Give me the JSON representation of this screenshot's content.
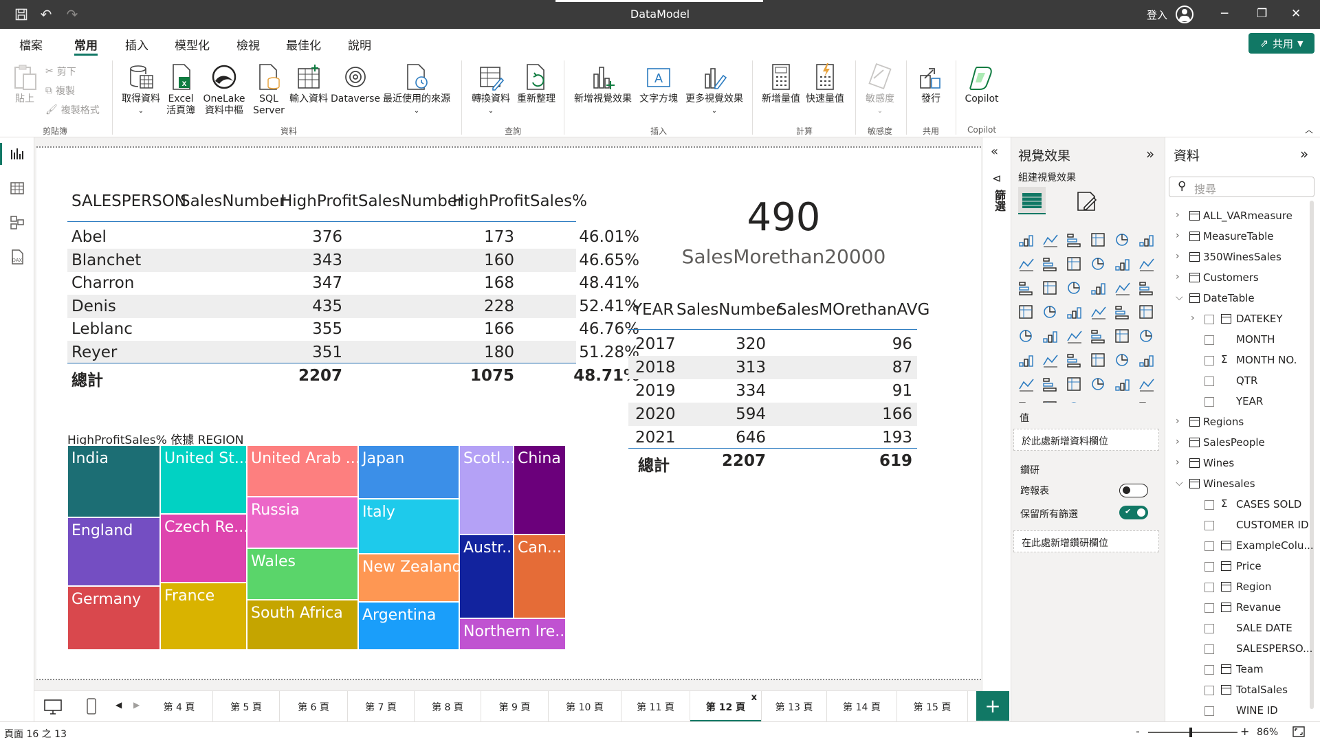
{
  "window": {
    "title": "DataModel",
    "login": "登入",
    "minimize": "─",
    "maximize": "❐",
    "close": "✕"
  },
  "menu": {
    "items": [
      "檔案",
      "常用",
      "插入",
      "模型化",
      "檢視",
      "最佳化",
      "說明"
    ],
    "active": "常用",
    "share": "共用"
  },
  "ribbon": {
    "clipboard": {
      "paste": "貼上",
      "cut": "剪下",
      "copy": "複製",
      "format_painter": "複製格式",
      "group": "剪貼簿"
    },
    "data": {
      "get_data": "取得資料",
      "excel": "Excel\n活頁簿",
      "onelake": "OneLake\n資料中樞",
      "sql": "SQL\nServer",
      "enter_data": "輸入資料",
      "dataverse": "Dataverse",
      "recent": "最近使用的來源",
      "group": "資料"
    },
    "query": {
      "transform": "轉換資料",
      "refresh": "重新整理",
      "group": "查詢"
    },
    "insert": {
      "new_visual": "新增視覺效果",
      "text_box": "文字方塊",
      "more_visuals": "更多視覺效果",
      "group": "插入"
    },
    "calc": {
      "new_measure": "新增量值",
      "quick_measure": "快速量值",
      "group": "計算"
    },
    "sensitivity": {
      "label": "敏感度",
      "group": "敏感度"
    },
    "share": {
      "publish": "發行",
      "group": "共用"
    },
    "copilot": {
      "label": "Copilot",
      "group": "Copilot"
    }
  },
  "table1": {
    "headers": [
      "SALESPERSON",
      "SalesNumber",
      "HighProfitSalesNumber",
      "HighProfitSales%"
    ],
    "rows": [
      [
        "Abel",
        "376",
        "173",
        "46.01%"
      ],
      [
        "Blanchet",
        "343",
        "160",
        "46.65%"
      ],
      [
        "Charron",
        "347",
        "168",
        "48.41%"
      ],
      [
        "Denis",
        "435",
        "228",
        "52.41%"
      ],
      [
        "Leblanc",
        "355",
        "166",
        "46.76%"
      ],
      [
        "Reyer",
        "351",
        "180",
        "51.28%"
      ]
    ],
    "total": [
      "總計",
      "2207",
      "1075",
      "48.71%"
    ]
  },
  "kpi": {
    "value": "490",
    "label": "SalesMorethan20000"
  },
  "table2": {
    "headers": [
      "YEAR",
      "SalesNumber",
      "SalesMOrethanAVG"
    ],
    "rows": [
      [
        "2017",
        "320",
        "96"
      ],
      [
        "2018",
        "313",
        "87"
      ],
      [
        "2019",
        "334",
        "91"
      ],
      [
        "2020",
        "594",
        "166"
      ],
      [
        "2021",
        "646",
        "193"
      ]
    ],
    "total": [
      "總計",
      "2207",
      "619"
    ]
  },
  "treemap": {
    "title": "HighProfitSales% 依據 REGION",
    "tiles": [
      {
        "label": "India",
        "color": "#1c6e74"
      },
      {
        "label": "England",
        "color": "#744ec2"
      },
      {
        "label": "Germany",
        "color": "#d9484d"
      },
      {
        "label": "United St...",
        "color": "#01d2c3"
      },
      {
        "label": "Czech Re...",
        "color": "#de44ae"
      },
      {
        "label": "France",
        "color": "#d9b300"
      },
      {
        "label": "United Arab ...",
        "color": "#fd7f7f"
      },
      {
        "label": "Russia",
        "color": "#ec67c8"
      },
      {
        "label": "Wales",
        "color": "#5ad56a"
      },
      {
        "label": "South Africa",
        "color": "#c5a500"
      },
      {
        "label": "Japan",
        "color": "#3b8fe8"
      },
      {
        "label": "Italy",
        "color": "#1ecaeb"
      },
      {
        "label": "New Zealand",
        "color": "#fe9753"
      },
      {
        "label": "Argentina",
        "color": "#1a9efa"
      },
      {
        "label": "Scotl...",
        "color": "#b4a1f6"
      },
      {
        "label": "China",
        "color": "#6b007b"
      },
      {
        "label": "Austr...",
        "color": "#12239e"
      },
      {
        "label": "Can...",
        "color": "#e56c37"
      },
      {
        "label": "Northern Ire...",
        "color": "#c052d1"
      }
    ]
  },
  "filters_pane": {
    "label": "篩選"
  },
  "viz_pane": {
    "title": "視覺效果",
    "build": "組建視覺效果",
    "values_label": "值",
    "values_drop": "於此處新增資料欄位",
    "drill_label": "鑽研",
    "cross_report": "跨報表",
    "keep_filters": "保留所有篩選",
    "drill_drop": "在此處新增鑽研欄位",
    "cross_report_state": "off",
    "keep_filters_state": "on"
  },
  "data_pane": {
    "title": "資料",
    "search_placeholder": "搜尋",
    "items": [
      {
        "label": "ALL_VARmeasure",
        "level": 0,
        "expanded": false,
        "icon": "calc-table"
      },
      {
        "label": "MeasureTable",
        "level": 0,
        "expanded": false,
        "icon": "calc-table"
      },
      {
        "label": "350WinesSales",
        "level": 0,
        "expanded": false,
        "icon": "table"
      },
      {
        "label": "Customers",
        "level": 0,
        "expanded": false,
        "icon": "table"
      },
      {
        "label": "DateTable",
        "level": 0,
        "expanded": true,
        "icon": "table"
      },
      {
        "label": "DATEKEY",
        "level": 1,
        "expanded": false,
        "icon": "date"
      },
      {
        "label": "MONTH",
        "level": 1,
        "icon": "none"
      },
      {
        "label": "MONTH NO.",
        "level": 1,
        "icon": "sigma"
      },
      {
        "label": "QTR",
        "level": 1,
        "icon": "none"
      },
      {
        "label": "YEAR",
        "level": 1,
        "icon": "none"
      },
      {
        "label": "Regions",
        "level": 0,
        "expanded": false,
        "icon": "table"
      },
      {
        "label": "SalesPeople",
        "level": 0,
        "expanded": false,
        "icon": "table"
      },
      {
        "label": "Wines",
        "level": 0,
        "expanded": false,
        "icon": "table"
      },
      {
        "label": "Winesales",
        "level": 0,
        "expanded": true,
        "icon": "table"
      },
      {
        "label": "CASES SOLD",
        "level": 1,
        "icon": "sigma"
      },
      {
        "label": "CUSTOMER ID",
        "level": 1,
        "icon": "none"
      },
      {
        "label": "ExampleColu...",
        "level": 1,
        "icon": "calc"
      },
      {
        "label": "Price",
        "level": 1,
        "icon": "calc"
      },
      {
        "label": "Region",
        "level": 1,
        "icon": "calc"
      },
      {
        "label": "Revanue",
        "level": 1,
        "icon": "calc"
      },
      {
        "label": "SALE DATE",
        "level": 1,
        "icon": "none"
      },
      {
        "label": "SALESPERSO...",
        "level": 1,
        "icon": "none"
      },
      {
        "label": "Team",
        "level": 1,
        "icon": "calc"
      },
      {
        "label": "TotalSales",
        "level": 1,
        "icon": "calc"
      },
      {
        "label": "WINE ID",
        "level": 1,
        "icon": "none"
      }
    ]
  },
  "tabs": {
    "items": [
      "第 4 頁",
      "第 5 頁",
      "第 6 頁",
      "第 7 頁",
      "第 8 頁",
      "第 9 頁",
      "第 10 頁",
      "第 11 頁",
      "第 12 頁",
      "第 13 頁",
      "第 14 頁",
      "第 15 頁"
    ],
    "active": "第 12 頁",
    "close": "x",
    "add": "+"
  },
  "status": {
    "page": "頁面 16 之 13",
    "zoom": "86%",
    "zoom_level": 0.86,
    "minus": "-",
    "plus": "+"
  }
}
